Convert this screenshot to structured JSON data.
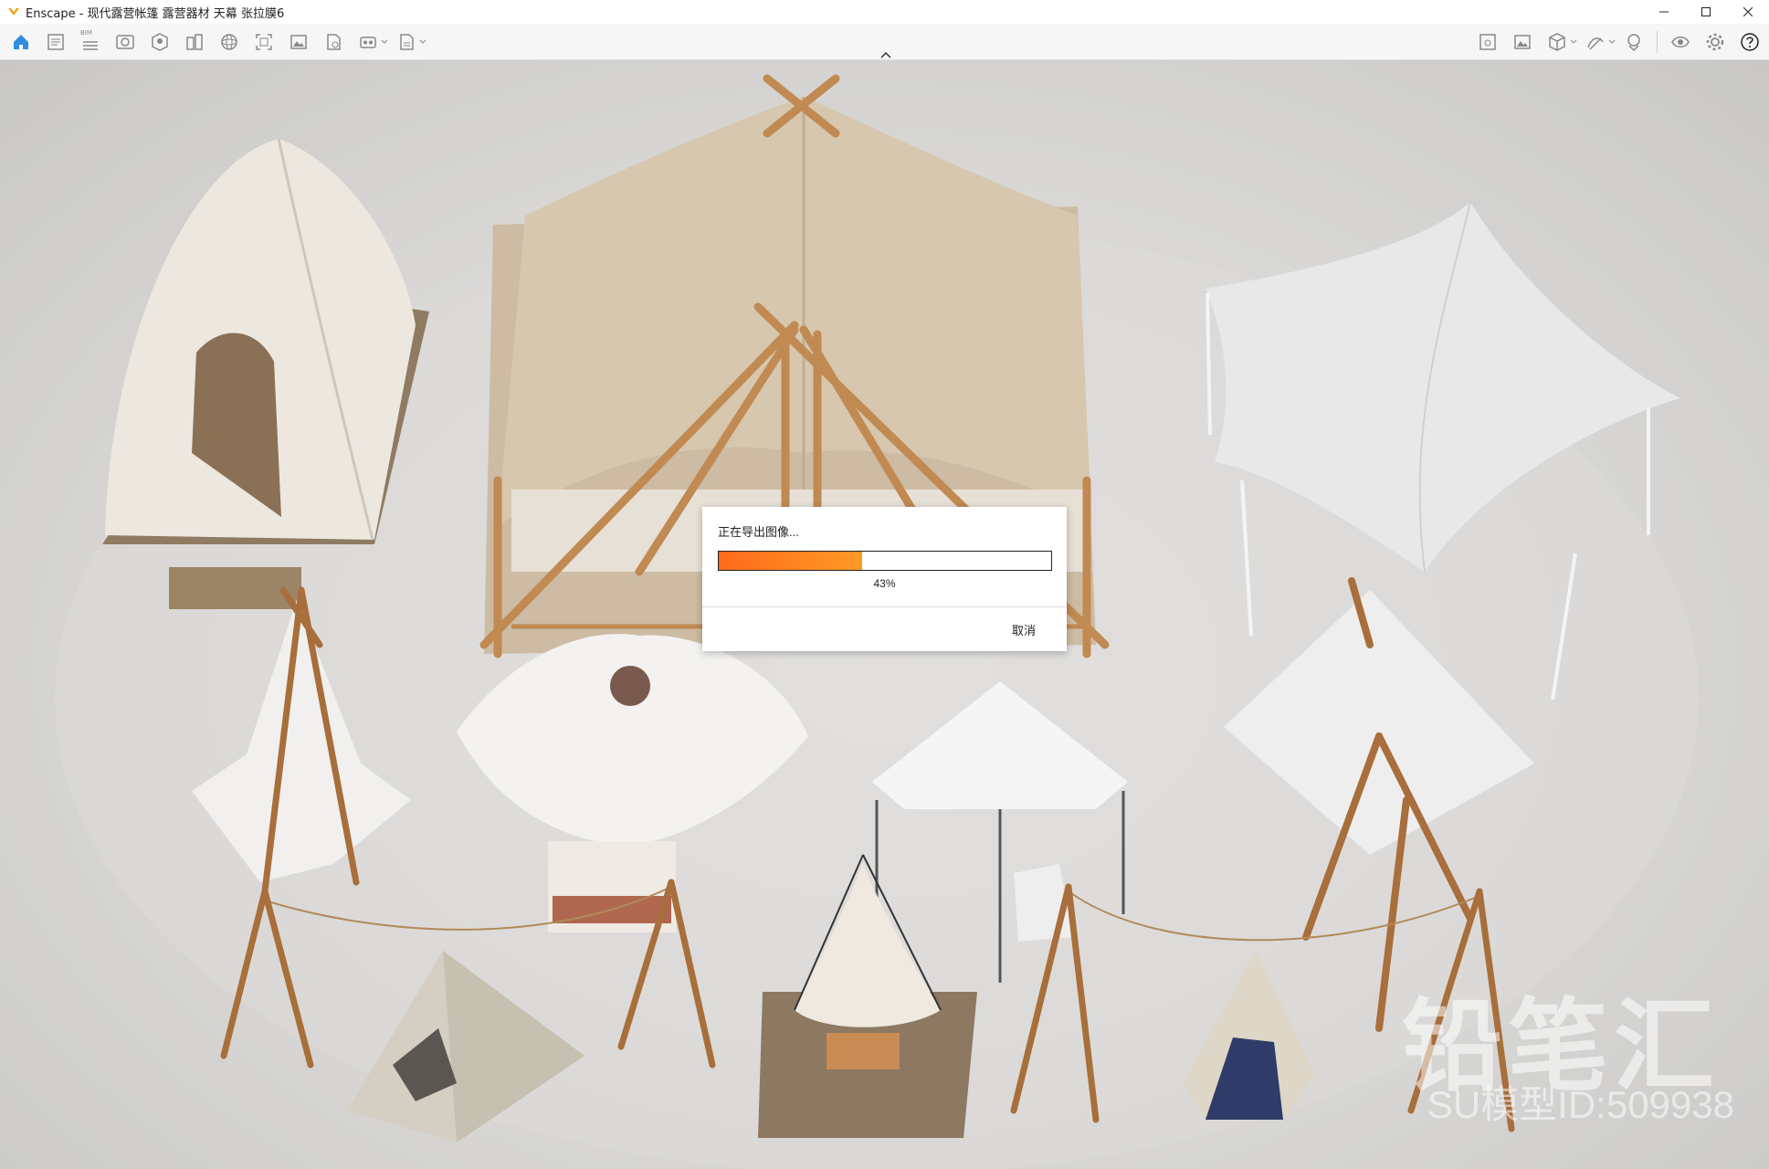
{
  "window": {
    "title": "Enscape - 现代露营帐篷 露营器材 天幕 张拉膜6",
    "brand_color": "#f2a31b"
  },
  "toolbar": {
    "left_icons": [
      "home-icon",
      "project-info-icon",
      "bim-icon",
      "visual-settings-icon",
      "asset-library-icon",
      "material-editor-icon",
      "panorama-icon",
      "screenshot-icon",
      "image-export-icon",
      "batch-render-icon",
      "video-editor-icon",
      "export-icon"
    ],
    "bim_label": "BIM",
    "right_icons": [
      "view-management-icon",
      "image-gallery-icon",
      "3d-view-icon",
      "sketch-icon",
      "live-update-icon",
      "visibility-icon",
      "settings-icon",
      "help-icon"
    ],
    "active_color": "#2f8fdc"
  },
  "dialog": {
    "title": "正在导出图像...",
    "progress": 0.43,
    "progress_label": "43%",
    "cancel_label": "取消"
  },
  "watermark": {
    "brand": "铅笔汇",
    "model_id": "SU模型ID:509938"
  }
}
